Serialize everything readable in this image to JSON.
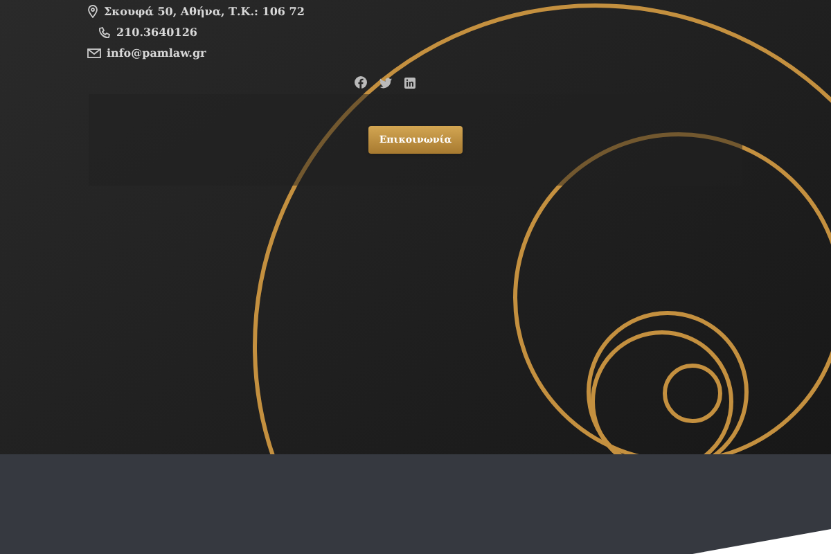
{
  "contact": [
    {
      "kind": "address",
      "text": "Σκουφά 50, Αθήνα, Τ.Κ.: 106 72"
    },
    {
      "kind": "phone",
      "text": "210.3640126"
    },
    {
      "kind": "email",
      "text": "info@pamlaw.gr"
    }
  ],
  "social": [
    {
      "kind": "facebook"
    },
    {
      "kind": "twitter"
    },
    {
      "kind": "linkedin"
    }
  ],
  "cta": {
    "label": "Επικοινωνία"
  }
}
